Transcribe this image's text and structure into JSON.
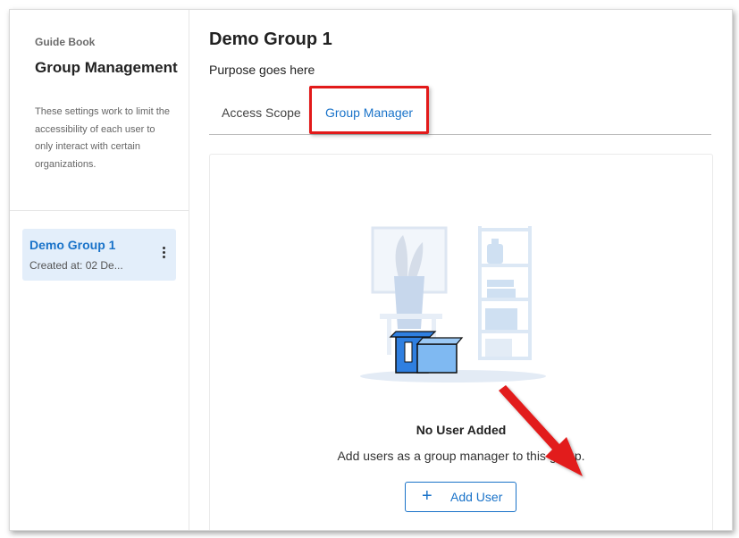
{
  "sidebar": {
    "breadcrumb": "Guide Book",
    "title": "Group Management",
    "description": "These settings work to limit the accessibility of each user to only interact with certain organizations.",
    "groups": [
      {
        "name": "Demo Group 1",
        "created": "Created at: 02 De..."
      }
    ]
  },
  "main": {
    "title": "Demo Group 1",
    "purpose": "Purpose goes here",
    "tabs": [
      {
        "label": "Access Scope",
        "active": false
      },
      {
        "label": "Group Manager",
        "active": true
      }
    ],
    "empty_state": {
      "title": "No User Added",
      "description": "Add users as a group manager to this group.",
      "button_label": "Add User",
      "button_icon": "plus-icon"
    }
  },
  "colors": {
    "accent": "#1a73c9",
    "highlight_box": "#e21a1a",
    "active_group_bg": "#e3eefa"
  }
}
